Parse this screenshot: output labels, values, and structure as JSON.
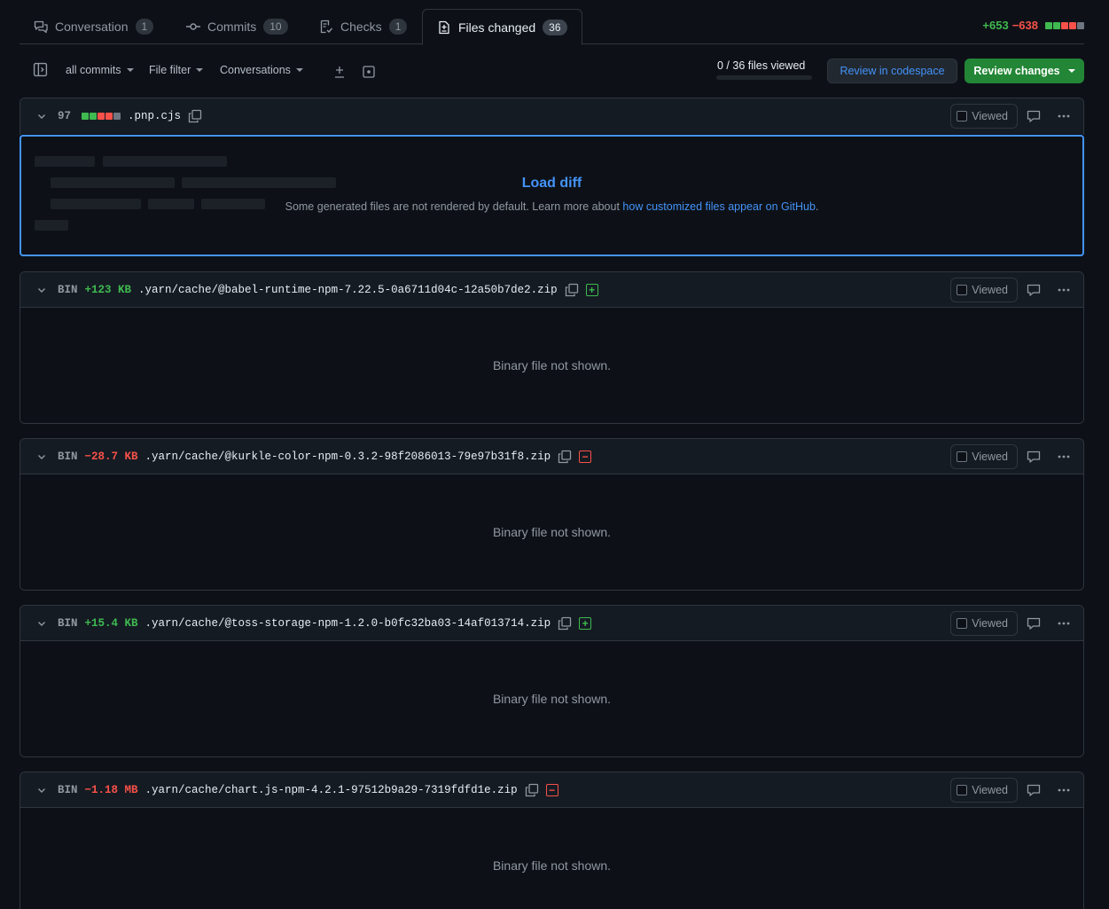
{
  "tabs": [
    {
      "label": "Conversation",
      "count": "1"
    },
    {
      "label": "Commits",
      "count": "10"
    },
    {
      "label": "Checks",
      "count": "1"
    },
    {
      "label": "Files changed",
      "count": "36"
    }
  ],
  "diffstat": {
    "additions": "+653",
    "deletions": "−638",
    "blocks": [
      "#3fb950",
      "#3fb950",
      "#f85149",
      "#f85149",
      "#6e7681"
    ]
  },
  "toolbar": {
    "all_commits": "all commits",
    "file_filter": "File filter",
    "conversations": "Conversations",
    "files_viewed": "0 / 36 files viewed",
    "files_viewed_progress": 0,
    "codespace": "Review in codespace",
    "review": "Review changes"
  },
  "files": [
    {
      "tag": "97",
      "size": "",
      "name": ".pnp.cjs",
      "change": "blocks",
      "blocks": [
        "#3fb950",
        "#3fb950",
        "#f85149",
        "#f85149",
        "#6e7681"
      ],
      "viewed": "Viewed"
    },
    {
      "tag": "BIN",
      "size": "+123 KB",
      "name": ".yarn/cache/@babel-runtime-npm-7.22.5-0a6711d04c-12a50b7de2.zip",
      "change": "add",
      "viewed": "Viewed",
      "body": "Binary file not shown."
    },
    {
      "tag": "BIN",
      "size": "−28.7 KB",
      "name": ".yarn/cache/@kurkle-color-npm-0.3.2-98f2086013-79e97b31f8.zip",
      "change": "del",
      "viewed": "Viewed",
      "body": "Binary file not shown."
    },
    {
      "tag": "BIN",
      "size": "+15.4 KB",
      "name": ".yarn/cache/@toss-storage-npm-1.2.0-b0fc32ba03-14af013714.zip",
      "change": "add",
      "viewed": "Viewed",
      "body": "Binary file not shown."
    },
    {
      "tag": "BIN",
      "size": "−1.18 MB",
      "name": ".yarn/cache/chart.js-npm-4.2.1-97512b9a29-7319fdfd1e.zip",
      "change": "del",
      "viewed": "Viewed",
      "body": "Binary file not shown."
    }
  ],
  "load_diff": {
    "title": "Load diff",
    "text": "Some generated files are not rendered by default. Learn more about ",
    "link": "how customized files appear on GitHub",
    "suffix": "."
  }
}
